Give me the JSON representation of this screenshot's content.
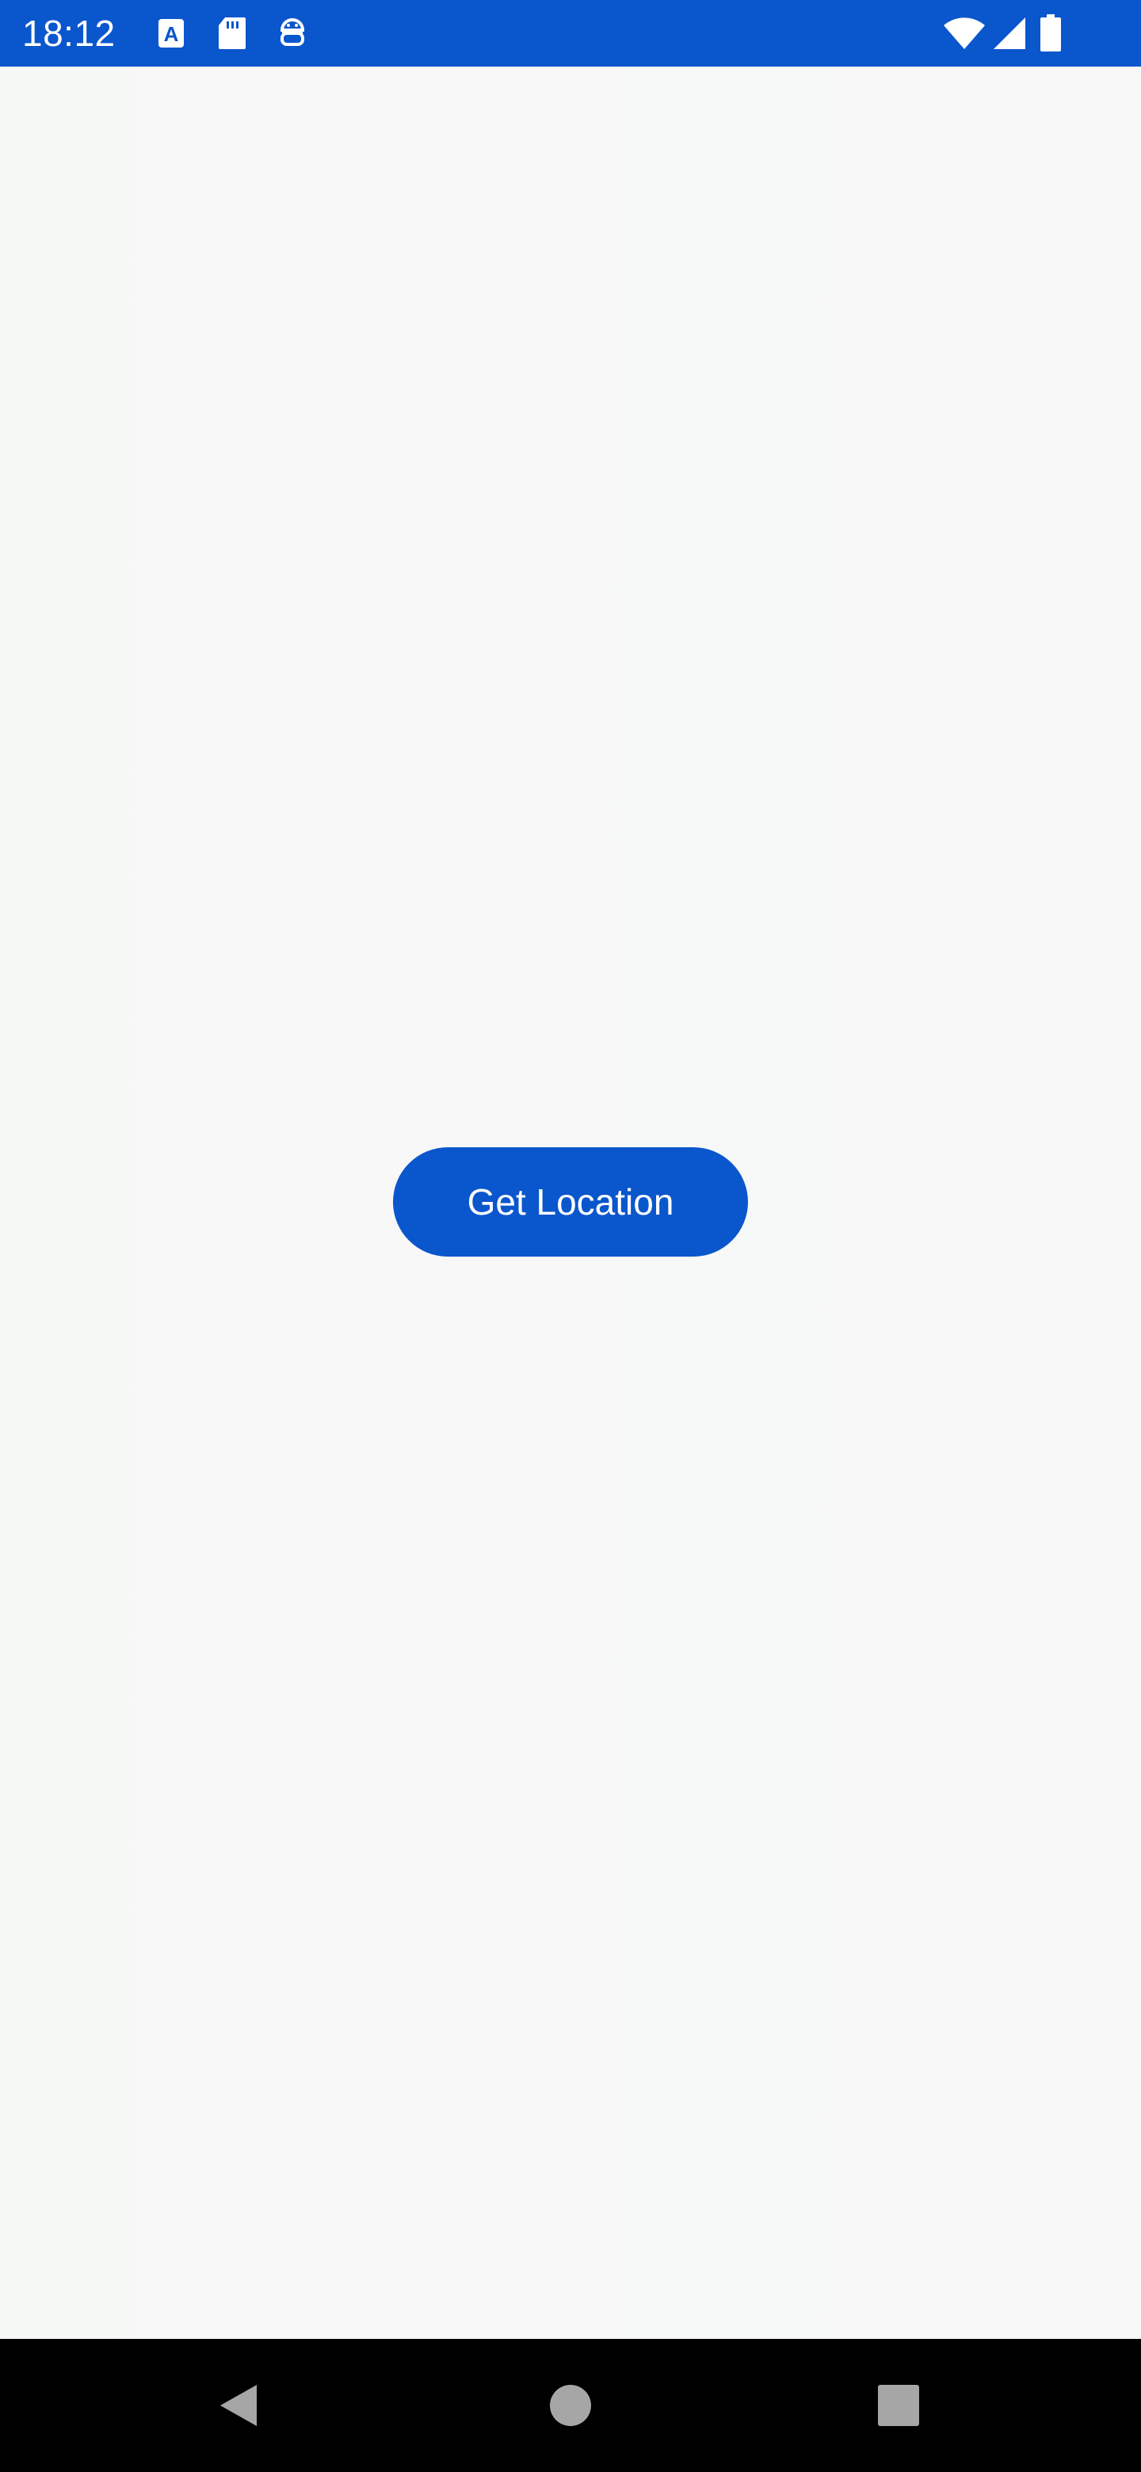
{
  "status_bar": {
    "time": "18:12",
    "background_color": "#0a56cc",
    "icons": [
      "a-app-icon",
      "sd-card-icon",
      "android-debug-icon",
      "wifi-icon",
      "cellular-signal-icon",
      "battery-icon"
    ]
  },
  "main": {
    "button_label": "Get Location",
    "button_color": "#0a56cc",
    "background_color": "#f7f8f7"
  },
  "nav_bar": {
    "buttons": [
      "back-icon",
      "home-icon",
      "recents-icon"
    ],
    "background_color": "#000000"
  }
}
